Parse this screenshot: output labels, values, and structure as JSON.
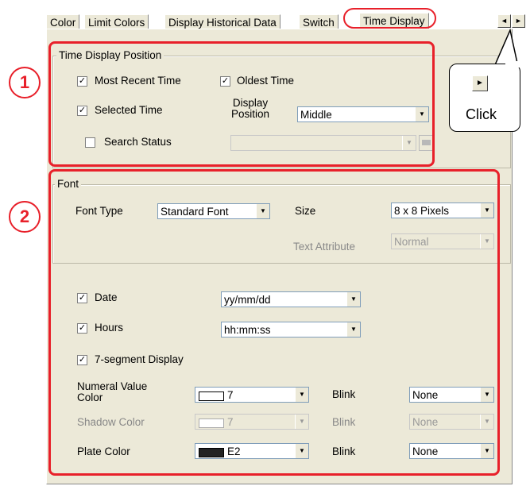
{
  "tabs": [
    "Color",
    "Limit Colors",
    "Display Historical Data",
    "Switch",
    "Time Display"
  ],
  "tab_nav": {
    "left": "◄",
    "right": "►"
  },
  "callout": {
    "text": "Click",
    "button_glyph": "►"
  },
  "markers": [
    "1",
    "2"
  ],
  "time_display_position": {
    "title": "Time Display Position",
    "most_recent_time": "Most Recent Time",
    "oldest_time": "Oldest Time",
    "selected_time": "Selected Time",
    "display_position_label": "Display\nPosition",
    "display_position_value": "Middle",
    "search_status": "Search Status"
  },
  "font": {
    "title": "Font",
    "font_type_label": "Font Type",
    "font_type_value": "Standard Font",
    "size_label": "Size",
    "size_value": "8 x 8 Pixels",
    "text_attribute_label": "Text Attribute",
    "text_attribute_value": "Normal"
  },
  "date": {
    "label": "Date",
    "value": "yy/mm/dd"
  },
  "hours": {
    "label": "Hours",
    "value": "hh:mm:ss"
  },
  "seven_segment": {
    "label": "7-segment Display"
  },
  "numeral_color": {
    "label": "Numeral Value\nColor",
    "value": "7",
    "swatch": "#ffffff",
    "blink_label": "Blink",
    "blink_value": "None"
  },
  "shadow_color": {
    "label": "Shadow Color",
    "value": "7",
    "swatch": "#ffffff",
    "blink_label": "Blink",
    "blink_value": "None"
  },
  "plate_color": {
    "label": "Plate Color",
    "value": "E2",
    "swatch": "#222222",
    "blink_label": "Blink",
    "blink_value": "None"
  },
  "check": "✓",
  "dropdown_glyph": "▼",
  "accent": "#e8202a"
}
